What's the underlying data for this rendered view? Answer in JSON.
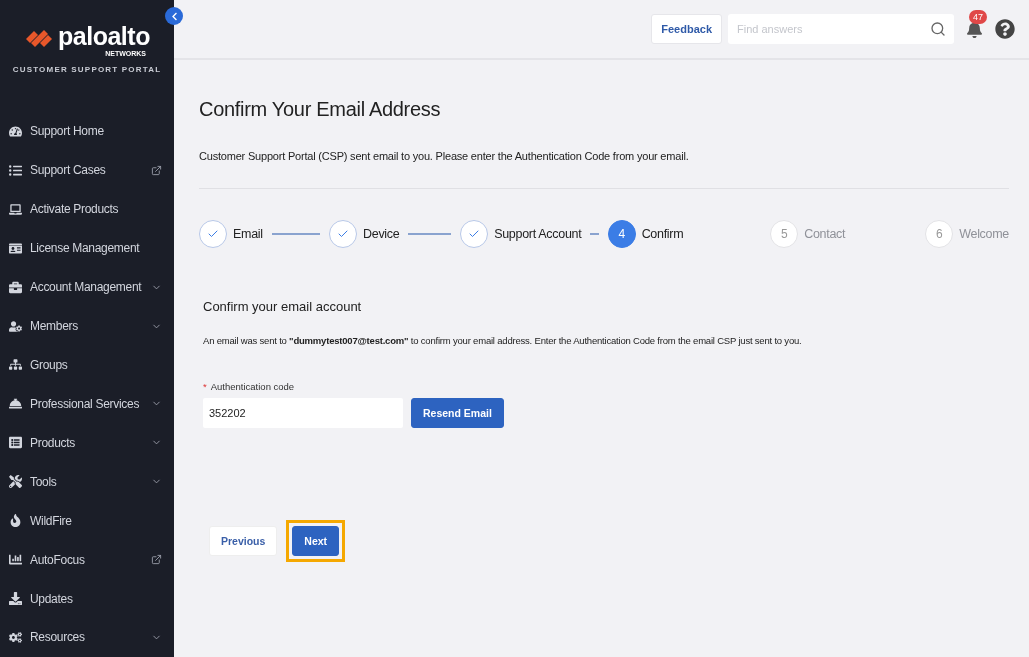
{
  "logo": {
    "wordmark": "paloalto",
    "sub": "NETWORKS",
    "portal": "CUSTOMER SUPPORT PORTAL"
  },
  "sidebar": {
    "items": [
      {
        "label": "Support Home",
        "external": false,
        "expandable": false
      },
      {
        "label": "Support Cases",
        "external": true,
        "expandable": false
      },
      {
        "label": "Activate Products",
        "external": false,
        "expandable": false
      },
      {
        "label": "License Management",
        "external": false,
        "expandable": false
      },
      {
        "label": "Account Management",
        "external": false,
        "expandable": true
      },
      {
        "label": "Members",
        "external": false,
        "expandable": true
      },
      {
        "label": "Groups",
        "external": false,
        "expandable": false
      },
      {
        "label": "Professional Services",
        "external": false,
        "expandable": true
      },
      {
        "label": "Products",
        "external": false,
        "expandable": true
      },
      {
        "label": "Tools",
        "external": false,
        "expandable": true
      },
      {
        "label": "WildFire",
        "external": false,
        "expandable": false
      },
      {
        "label": "AutoFocus",
        "external": true,
        "expandable": false
      },
      {
        "label": "Updates",
        "external": false,
        "expandable": false
      },
      {
        "label": "Resources",
        "external": false,
        "expandable": true
      }
    ]
  },
  "topbar": {
    "feedback": "Feedback",
    "search": {
      "placeholder": "Find answers"
    },
    "notifications": "47"
  },
  "page": {
    "title": "Confirm Your Email Address",
    "intro": "Customer Support Portal (CSP) sent email to you. Please enter the Authentication Code from your email."
  },
  "steps": [
    {
      "label": "Email",
      "completed": true,
      "selected": false
    },
    {
      "label": "Device",
      "completed": true,
      "selected": false
    },
    {
      "label": "Support Account",
      "completed": true,
      "selected": false
    },
    {
      "number": "4",
      "label": "Confirm",
      "completed": false,
      "selected": true
    },
    {
      "number": "5",
      "label": "Contact",
      "completed": false,
      "selected": false
    },
    {
      "number": "6",
      "label": "Welcome",
      "completed": false,
      "selected": false
    }
  ],
  "form": {
    "heading": "Confirm your email account",
    "message": "An email was sent to **\"dummytest007@test.com\"** to confirm your email address. Enter the Authentication Code from the email CSP just sent to you.",
    "required_mark": "*",
    "field_label": "Authentication code",
    "value": "352202",
    "resend": "Resend Email"
  },
  "buttons": [
    {
      "label": "Previous",
      "kind": "secondary",
      "highlighted": false
    },
    {
      "label": "Next",
      "kind": "primary",
      "highlighted": true
    }
  ]
}
